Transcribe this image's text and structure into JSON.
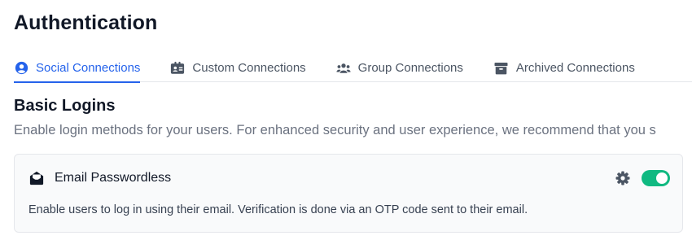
{
  "header": {
    "title": "Authentication"
  },
  "tabs": [
    {
      "label": "Social Connections",
      "icon": "user-circle-icon",
      "active": true
    },
    {
      "label": "Custom Connections",
      "icon": "id-card-icon",
      "active": false
    },
    {
      "label": "Group Connections",
      "icon": "users-icon",
      "active": false
    },
    {
      "label": "Archived Connections",
      "icon": "archive-box-icon",
      "active": false
    }
  ],
  "section": {
    "title": "Basic Logins",
    "description": "Enable login methods for your users. For enhanced security and user experience, we recommend that you s"
  },
  "connection": {
    "title": "Email Passwordless",
    "icon": "envelope-open-icon",
    "description": "Enable users to log in using their email. Verification is done via an OTP code sent to their email.",
    "enabled": true
  },
  "colors": {
    "accent": "#2563eb",
    "toggle_on": "#10b981"
  }
}
